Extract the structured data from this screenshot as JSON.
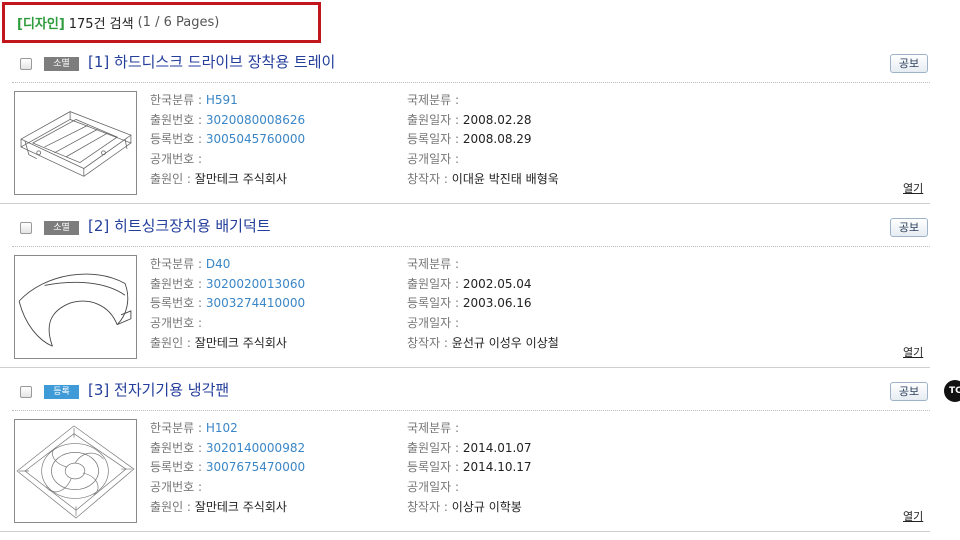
{
  "summary": {
    "category": "[디자인]",
    "count": "175건 검색",
    "pages": "(1 / 6 Pages)"
  },
  "labels": {
    "kr_class": "한국분류 : ",
    "intl_class": "국제분류 : ",
    "app_no": "출원번호 : ",
    "app_date": "출원일자 : ",
    "reg_no": "등록번호 : ",
    "reg_date": "등록일자 : ",
    "pub_no": "공개번호 : ",
    "pub_date": "공개일자 : ",
    "applicant": "출원인 : ",
    "creator": "창작자 : ",
    "pub_button": "공보",
    "open": "열기"
  },
  "results": [
    {
      "status": "소멸",
      "title": "[1] 하드디스크 드라이브 장착용 트레이",
      "kr_class": "H591",
      "intl_class": "",
      "app_no": "3020080008626",
      "app_date": "2008.02.28",
      "reg_no": "3005045760000",
      "reg_date": "2008.08.29",
      "pub_no": "",
      "pub_date": "",
      "applicant": "잘만테크 주식회사",
      "creator": "이대윤 박진태 배형욱"
    },
    {
      "status": "소멸",
      "title": "[2] 히트싱크장치용 배기덕트",
      "kr_class": "D40",
      "intl_class": "",
      "app_no": "3020020013060",
      "app_date": "2002.05.04",
      "reg_no": "3003274410000",
      "reg_date": "2003.06.16",
      "pub_no": "",
      "pub_date": "",
      "applicant": "잘만테크 주식회사",
      "creator": "윤선규 이성우 이상철"
    },
    {
      "status": "등록",
      "title": "[3] 전자기기용 냉각팬",
      "kr_class": "H102",
      "intl_class": "",
      "app_no": "3020140000982",
      "app_date": "2014.01.07",
      "reg_no": "3007675470000",
      "reg_date": "2014.10.17",
      "pub_no": "",
      "pub_date": "",
      "applicant": "잘만테크 주식회사",
      "creator": "이상규 이학봉"
    }
  ],
  "colors": {
    "title_link": "#233e9b",
    "field_link": "#3a86c6",
    "status_extinct": "#7d7d7d",
    "status_registered": "#3f9ad8",
    "highlight_border": "#c0161c",
    "category": "#2e9c3c"
  },
  "side_icon": "TC"
}
